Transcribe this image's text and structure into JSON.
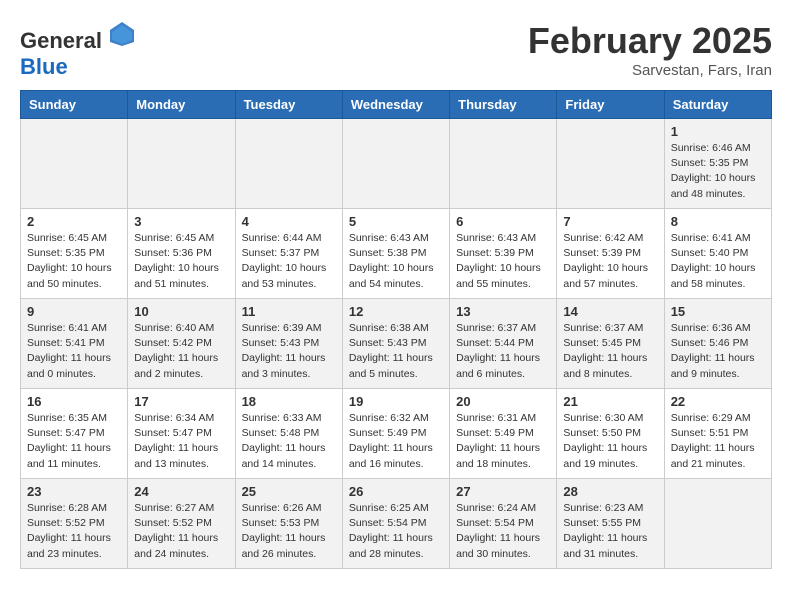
{
  "header": {
    "logo": {
      "general": "General",
      "blue": "Blue"
    },
    "title": "February 2025",
    "subtitle": "Sarvestan, Fars, Iran"
  },
  "weekdays": [
    "Sunday",
    "Monday",
    "Tuesday",
    "Wednesday",
    "Thursday",
    "Friday",
    "Saturday"
  ],
  "weeks": [
    [
      {
        "day": "",
        "info": ""
      },
      {
        "day": "",
        "info": ""
      },
      {
        "day": "",
        "info": ""
      },
      {
        "day": "",
        "info": ""
      },
      {
        "day": "",
        "info": ""
      },
      {
        "day": "",
        "info": ""
      },
      {
        "day": "1",
        "info": "Sunrise: 6:46 AM\nSunset: 5:35 PM\nDaylight: 10 hours\nand 48 minutes."
      }
    ],
    [
      {
        "day": "2",
        "info": "Sunrise: 6:45 AM\nSunset: 5:35 PM\nDaylight: 10 hours\nand 50 minutes."
      },
      {
        "day": "3",
        "info": "Sunrise: 6:45 AM\nSunset: 5:36 PM\nDaylight: 10 hours\nand 51 minutes."
      },
      {
        "day": "4",
        "info": "Sunrise: 6:44 AM\nSunset: 5:37 PM\nDaylight: 10 hours\nand 53 minutes."
      },
      {
        "day": "5",
        "info": "Sunrise: 6:43 AM\nSunset: 5:38 PM\nDaylight: 10 hours\nand 54 minutes."
      },
      {
        "day": "6",
        "info": "Sunrise: 6:43 AM\nSunset: 5:39 PM\nDaylight: 10 hours\nand 55 minutes."
      },
      {
        "day": "7",
        "info": "Sunrise: 6:42 AM\nSunset: 5:39 PM\nDaylight: 10 hours\nand 57 minutes."
      },
      {
        "day": "8",
        "info": "Sunrise: 6:41 AM\nSunset: 5:40 PM\nDaylight: 10 hours\nand 58 minutes."
      }
    ],
    [
      {
        "day": "9",
        "info": "Sunrise: 6:41 AM\nSunset: 5:41 PM\nDaylight: 11 hours\nand 0 minutes."
      },
      {
        "day": "10",
        "info": "Sunrise: 6:40 AM\nSunset: 5:42 PM\nDaylight: 11 hours\nand 2 minutes."
      },
      {
        "day": "11",
        "info": "Sunrise: 6:39 AM\nSunset: 5:43 PM\nDaylight: 11 hours\nand 3 minutes."
      },
      {
        "day": "12",
        "info": "Sunrise: 6:38 AM\nSunset: 5:43 PM\nDaylight: 11 hours\nand 5 minutes."
      },
      {
        "day": "13",
        "info": "Sunrise: 6:37 AM\nSunset: 5:44 PM\nDaylight: 11 hours\nand 6 minutes."
      },
      {
        "day": "14",
        "info": "Sunrise: 6:37 AM\nSunset: 5:45 PM\nDaylight: 11 hours\nand 8 minutes."
      },
      {
        "day": "15",
        "info": "Sunrise: 6:36 AM\nSunset: 5:46 PM\nDaylight: 11 hours\nand 9 minutes."
      }
    ],
    [
      {
        "day": "16",
        "info": "Sunrise: 6:35 AM\nSunset: 5:47 PM\nDaylight: 11 hours\nand 11 minutes."
      },
      {
        "day": "17",
        "info": "Sunrise: 6:34 AM\nSunset: 5:47 PM\nDaylight: 11 hours\nand 13 minutes."
      },
      {
        "day": "18",
        "info": "Sunrise: 6:33 AM\nSunset: 5:48 PM\nDaylight: 11 hours\nand 14 minutes."
      },
      {
        "day": "19",
        "info": "Sunrise: 6:32 AM\nSunset: 5:49 PM\nDaylight: 11 hours\nand 16 minutes."
      },
      {
        "day": "20",
        "info": "Sunrise: 6:31 AM\nSunset: 5:49 PM\nDaylight: 11 hours\nand 18 minutes."
      },
      {
        "day": "21",
        "info": "Sunrise: 6:30 AM\nSunset: 5:50 PM\nDaylight: 11 hours\nand 19 minutes."
      },
      {
        "day": "22",
        "info": "Sunrise: 6:29 AM\nSunset: 5:51 PM\nDaylight: 11 hours\nand 21 minutes."
      }
    ],
    [
      {
        "day": "23",
        "info": "Sunrise: 6:28 AM\nSunset: 5:52 PM\nDaylight: 11 hours\nand 23 minutes."
      },
      {
        "day": "24",
        "info": "Sunrise: 6:27 AM\nSunset: 5:52 PM\nDaylight: 11 hours\nand 24 minutes."
      },
      {
        "day": "25",
        "info": "Sunrise: 6:26 AM\nSunset: 5:53 PM\nDaylight: 11 hours\nand 26 minutes."
      },
      {
        "day": "26",
        "info": "Sunrise: 6:25 AM\nSunset: 5:54 PM\nDaylight: 11 hours\nand 28 minutes."
      },
      {
        "day": "27",
        "info": "Sunrise: 6:24 AM\nSunset: 5:54 PM\nDaylight: 11 hours\nand 30 minutes."
      },
      {
        "day": "28",
        "info": "Sunrise: 6:23 AM\nSunset: 5:55 PM\nDaylight: 11 hours\nand 31 minutes."
      },
      {
        "day": "",
        "info": ""
      }
    ]
  ]
}
